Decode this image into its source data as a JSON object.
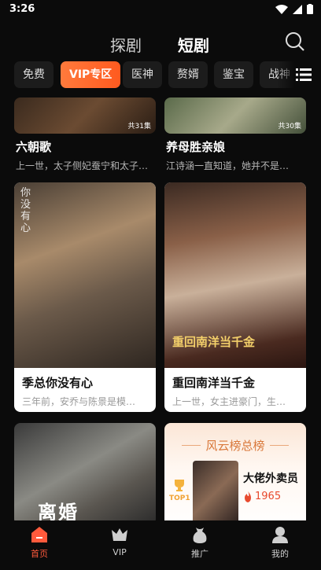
{
  "status": {
    "time": "3:26"
  },
  "top_tabs": [
    {
      "label": "探剧"
    },
    {
      "label": "短剧"
    }
  ],
  "chips": [
    {
      "label": "免费"
    },
    {
      "label": "VIP专区"
    },
    {
      "label": "医神"
    },
    {
      "label": "赘婿"
    },
    {
      "label": "鉴宝"
    },
    {
      "label": "战神"
    }
  ],
  "cards": [
    {
      "title": "六朝歌",
      "desc": "上一世，太子侧妃蚕宁和太子…",
      "episodes": "共31集"
    },
    {
      "title": "养母胜亲娘",
      "desc": "江诗涵一直知道，她并不是…",
      "episodes": "共30集"
    },
    {
      "title": "季总你没有心",
      "desc": "三年前，安乔与陈景是模…",
      "poster_text": "你没有心"
    },
    {
      "title": "重回南洋当千金",
      "desc": "上一世，女主进豪门，生…",
      "poster_text": "重回南洋当千金"
    },
    {
      "poster_text": "离婚"
    }
  ],
  "ranking": {
    "title": "风云榜总榜",
    "badge": "TOP1",
    "name": "大佬外卖员",
    "heat": "1965"
  },
  "tabbar": [
    {
      "label": "首页"
    },
    {
      "label": "VIP"
    },
    {
      "label": "推广"
    },
    {
      "label": "我的"
    }
  ],
  "colors": {
    "accent": "#ff5a1f",
    "active_tab": "#ff5a3c"
  }
}
